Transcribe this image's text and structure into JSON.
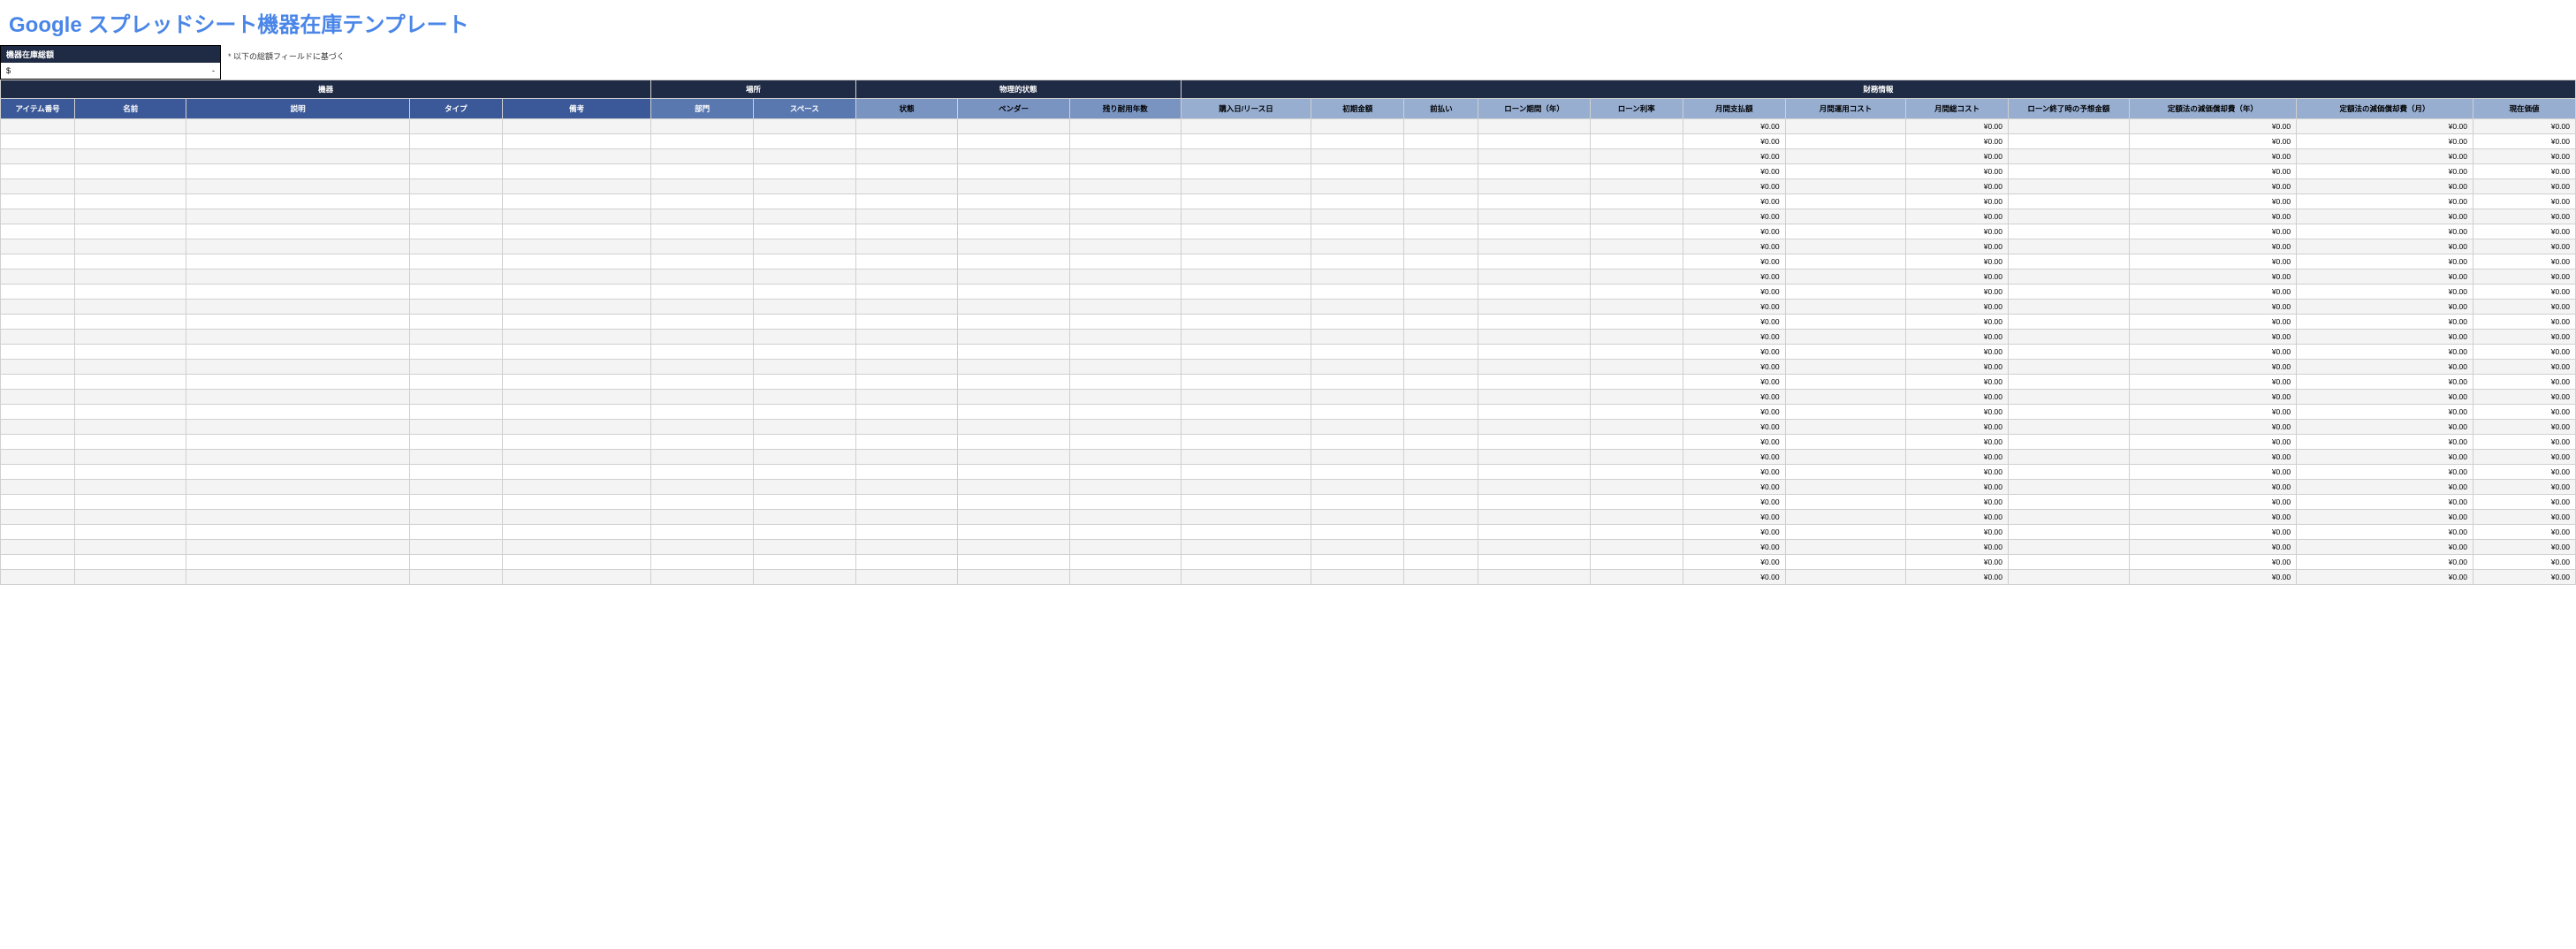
{
  "title": "Google スプレッドシート機器在庫テンプレート",
  "totalBox": {
    "label": "機器在庫総額",
    "currency": "$",
    "dash": "-",
    "note": "* 以下の総額フィールドに基づく"
  },
  "groups": {
    "equipment": "機器",
    "location": "場所",
    "physical": "物理的状態",
    "financial": "財務情報"
  },
  "columns": {
    "item_no": "アイテム番号",
    "name": "名前",
    "description": "説明",
    "type": "タイプ",
    "notes": "備考",
    "department": "部門",
    "space": "スペース",
    "status": "状態",
    "vendor": "ベンダー",
    "remaining_life": "残り耐用年数",
    "purchase_date": "購入日/リース日",
    "initial_cost": "初期金額",
    "down_payment": "前払い",
    "loan_term": "ローン期間（年）",
    "loan_rate": "ローン利率",
    "monthly_payment": "月間支払額",
    "monthly_op": "月間運用コスト",
    "monthly_total": "月間総コスト",
    "eol_expected": "ローン終了時の予想金額",
    "annual_dep": "定額法の減価償却費（年）",
    "monthly_dep": "定額法の減価償却費（月）",
    "current_value": "現在価値"
  },
  "zero": "¥0.00",
  "row_count": 31,
  "value_columns": [
    "monthly_payment",
    "monthly_total",
    "annual_dep",
    "monthly_dep",
    "current_value"
  ]
}
